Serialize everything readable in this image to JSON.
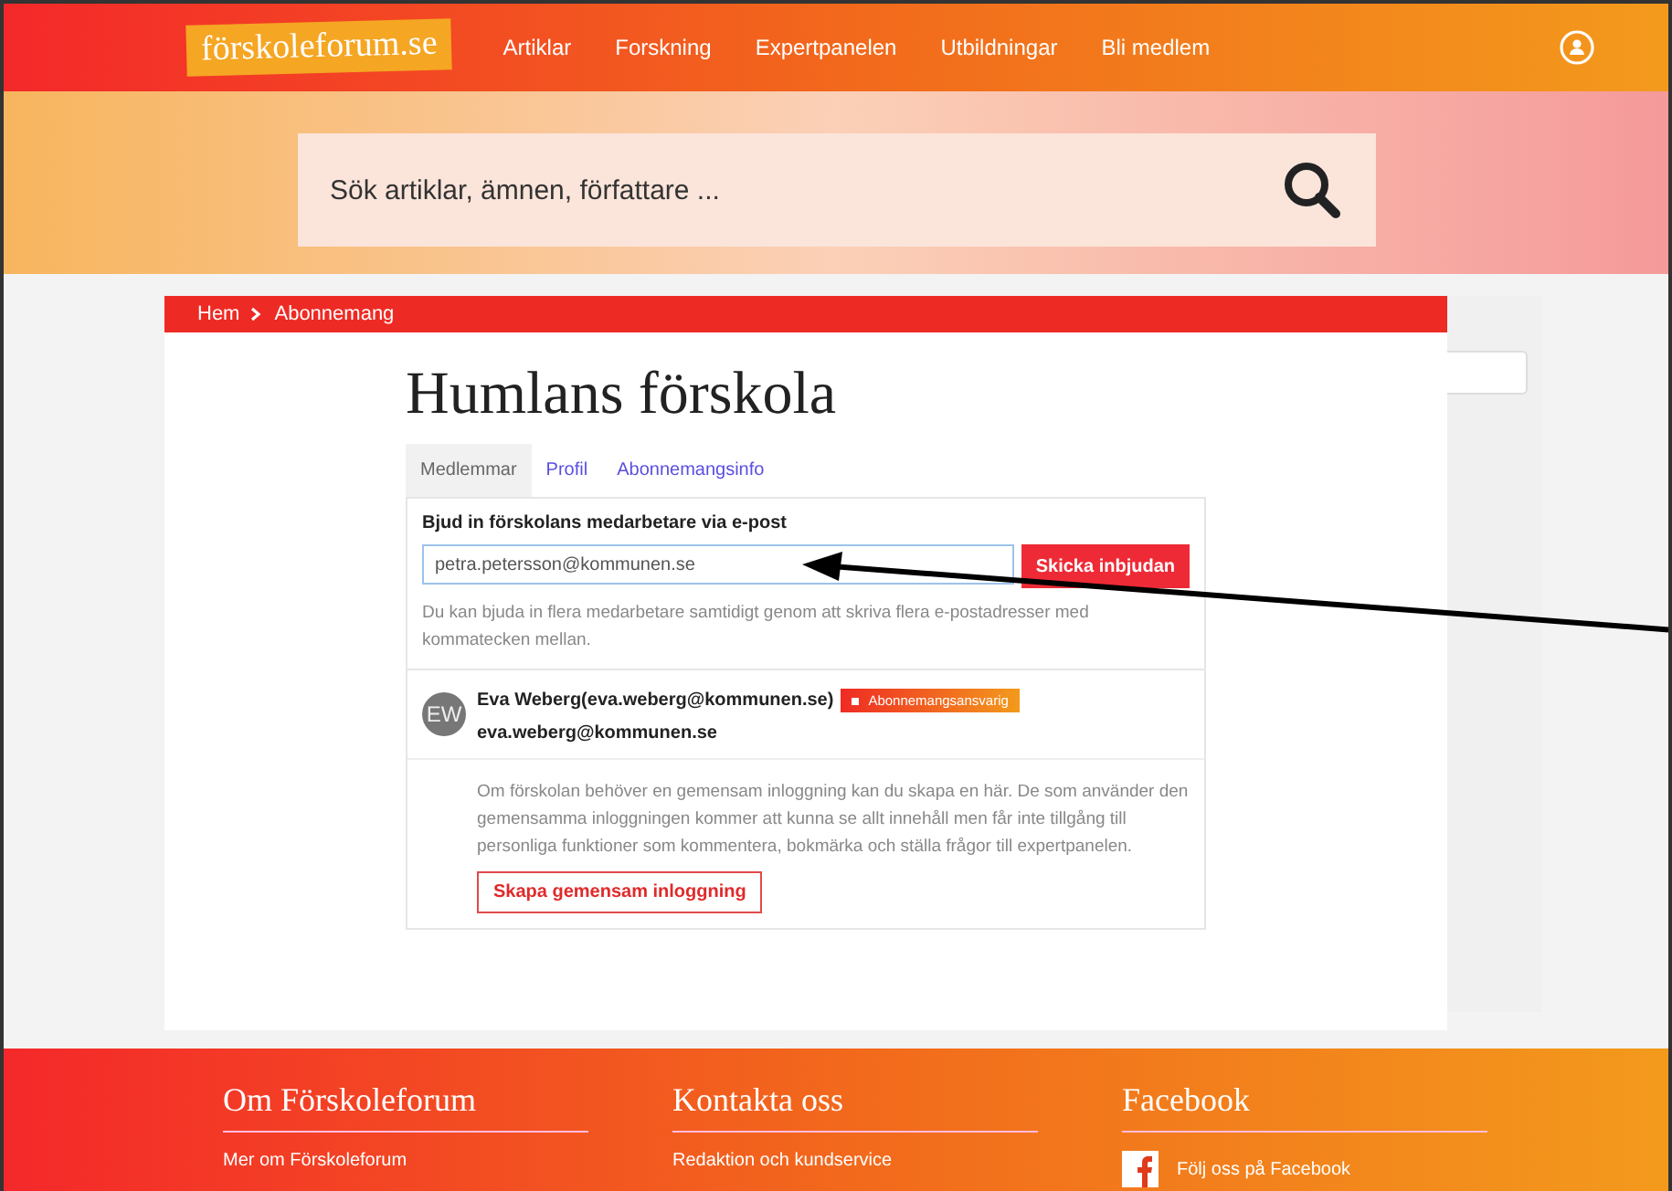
{
  "header": {
    "logo": "förskoleforum.se",
    "nav": [
      "Artiklar",
      "Forskning",
      "Expertpanelen",
      "Utbildningar",
      "Bli medlem"
    ]
  },
  "search": {
    "placeholder": "Sök artiklar, ämnen, författare ..."
  },
  "breadcrumb": [
    "Hem",
    "Abonnemang"
  ],
  "page_title": "Humlans förskola",
  "tabs": [
    {
      "label": "Medlemmar",
      "selected": true
    },
    {
      "label": "Profil",
      "selected": false
    },
    {
      "label": "Abonnemangsinfo",
      "selected": false
    }
  ],
  "invite": {
    "label": "Bjud in förskolans medarbetare via e-post",
    "value": "petra.petersson@kommunen.se",
    "button": "Skicka inbjudan",
    "help": "Du kan bjuda in flera medarbetare samtidigt genom att skriva flera e-postadresser med kommatecken mellan."
  },
  "members": [
    {
      "initials": "EW",
      "name": "Eva Weberg(eva.weberg@kommunen.se)",
      "badge": "Abonnemangsansvarig",
      "email": "eva.weberg@kommunen.se"
    }
  ],
  "shared_login": {
    "text": "Om förskolan behöver en gemensam inloggning kan du skapa en här. De som använder den gemensamma inloggningen kommer att kunna se allt innehåll men får inte tillgång till personliga funktioner som kommentera, bokmärka och ställa frågor till expertpanelen.",
    "button": "Skapa gemensam inloggning"
  },
  "footer": [
    {
      "title": "Om Förskoleforum",
      "link": "Mer om Förskoleforum",
      "kind": "text"
    },
    {
      "title": "Kontakta oss",
      "link": "Redaktion och kundservice",
      "kind": "text"
    },
    {
      "title": "Facebook",
      "link": "Följ oss på Facebook",
      "kind": "facebook"
    }
  ]
}
